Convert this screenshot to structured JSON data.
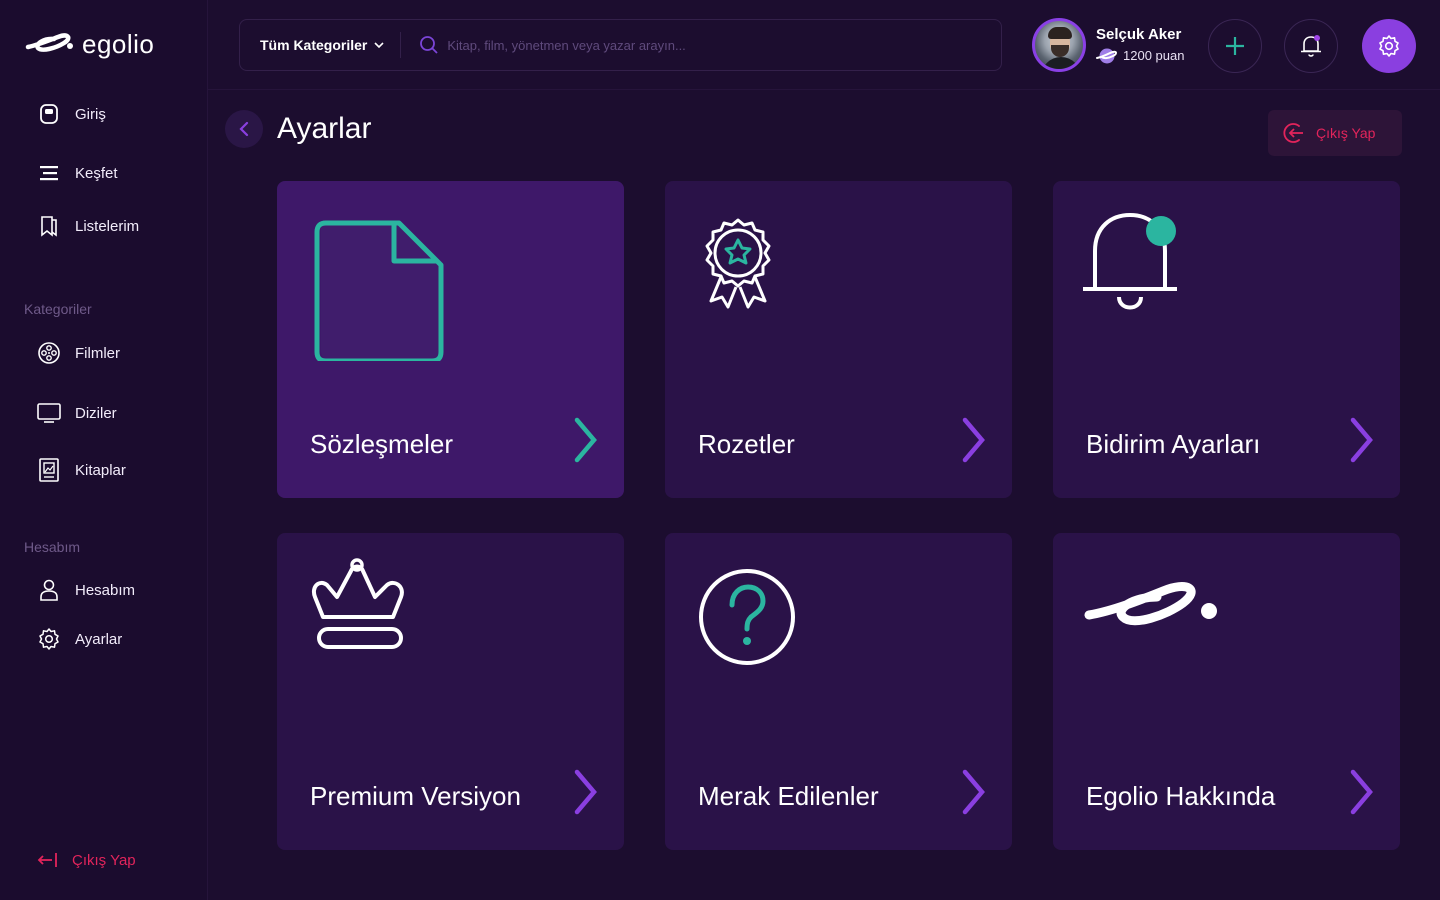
{
  "brand": {
    "name": "egolio"
  },
  "sidebar": {
    "main_items": [
      {
        "label": "Giriş",
        "icon": "home-icon"
      },
      {
        "label": "Keşfet",
        "icon": "discover-icon"
      },
      {
        "label": "Listelerim",
        "icon": "bookmark-icon"
      }
    ],
    "categories_title": "Kategoriler",
    "categories": [
      {
        "label": "Filmler",
        "icon": "film-reel-icon"
      },
      {
        "label": "Diziler",
        "icon": "tv-icon"
      },
      {
        "label": "Kitaplar",
        "icon": "book-icon"
      }
    ],
    "account_title": "Hesabım",
    "account": [
      {
        "label": "Hesabım",
        "icon": "user-icon"
      },
      {
        "label": "Ayarlar",
        "icon": "gear-icon"
      }
    ],
    "logout_label": "Çıkış Yap"
  },
  "search": {
    "category_label": "Tüm Kategoriler",
    "placeholder": "Kitap, film, yönetmen veya yazar arayın..."
  },
  "user": {
    "name": "Selçuk Aker",
    "points": "1200 puan"
  },
  "page": {
    "title": "Ayarlar",
    "logout_label": "Çıkış Yap"
  },
  "cards": [
    {
      "label": "Sözleşmeler",
      "icon": "document-icon",
      "active": true
    },
    {
      "label": "Rozetler",
      "icon": "badge-icon",
      "active": false
    },
    {
      "label": "Bidirim Ayarları",
      "icon": "notification-bell-icon",
      "active": false
    },
    {
      "label": "Premium Versiyon",
      "icon": "crown-icon",
      "active": false
    },
    {
      "label": "Merak Edilenler",
      "icon": "question-icon",
      "active": false
    },
    {
      "label": "Egolio Hakkında",
      "icon": "egolio-logo-icon",
      "active": false
    }
  ],
  "colors": {
    "background": "#1c0d2f",
    "card": "#2a1248",
    "card_active": "#3e1869",
    "accent_purple": "#8a3fe0",
    "accent_teal": "#2bb5a0",
    "danger": "#e2245b"
  }
}
